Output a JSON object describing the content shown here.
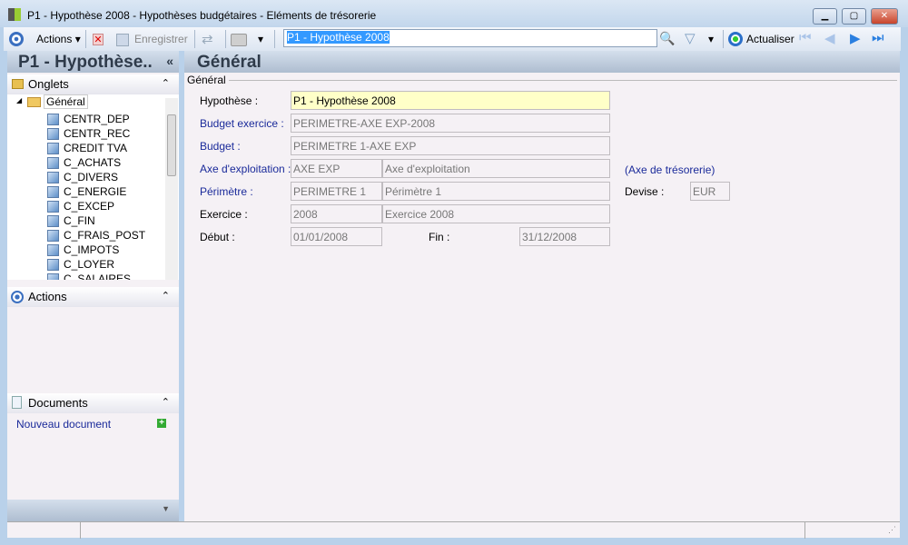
{
  "window": {
    "title": "P1 - Hypothèse 2008 -  Hypothèses budgétaires - Eléments de trésorerie",
    "minimize": "▁",
    "maximize": "▢",
    "close": "✕"
  },
  "toolbar": {
    "actions": "Actions",
    "save": "Enregistrer",
    "search_value": "P1 - Hypothèse 2008",
    "refresh": "Actualiser"
  },
  "sidebar": {
    "title": "P1 - Hypothèse..",
    "collapse": "«",
    "onglets": {
      "label": "Onglets",
      "root": "Général",
      "items": [
        "CENTR_DEP",
        "CENTR_REC",
        "CREDIT TVA",
        "C_ACHATS",
        "C_DIVERS",
        "C_ENERGIE",
        "C_EXCEP",
        "C_FIN",
        "C_FRAIS_POST",
        "C_IMPOTS",
        "C_LOYER",
        "C_SALAIRES"
      ]
    },
    "actions": {
      "label": "Actions"
    },
    "documents": {
      "label": "Documents",
      "new": "Nouveau document"
    }
  },
  "main": {
    "title": "Général",
    "group": "Général",
    "fields": {
      "hypothese": {
        "label": "Hypothèse :",
        "value": "P1 - Hypothèse 2008"
      },
      "budget_exercice": {
        "label": "Budget exercice :",
        "value": "PERIMETRE-AXE EXP-2008"
      },
      "budget": {
        "label": "Budget :",
        "value": "PERIMETRE 1-AXE EXP"
      },
      "axe": {
        "label": "Axe d'exploitation :",
        "code": "AXE EXP",
        "name": "Axe d'exploitation"
      },
      "perimetre": {
        "label": "Périmètre :",
        "code": "PERIMETRE 1",
        "name": "Périmètre 1"
      },
      "exercice": {
        "label": "Exercice :",
        "code": "2008",
        "name": "Exercice 2008"
      },
      "debut": {
        "label": "Début :",
        "value": "01/01/2008"
      },
      "fin": {
        "label": "Fin :",
        "value": "31/12/2008"
      },
      "axe_tresorerie": {
        "label": "(Axe de trésorerie)"
      },
      "devise": {
        "label": "Devise :",
        "value": "EUR"
      }
    }
  }
}
